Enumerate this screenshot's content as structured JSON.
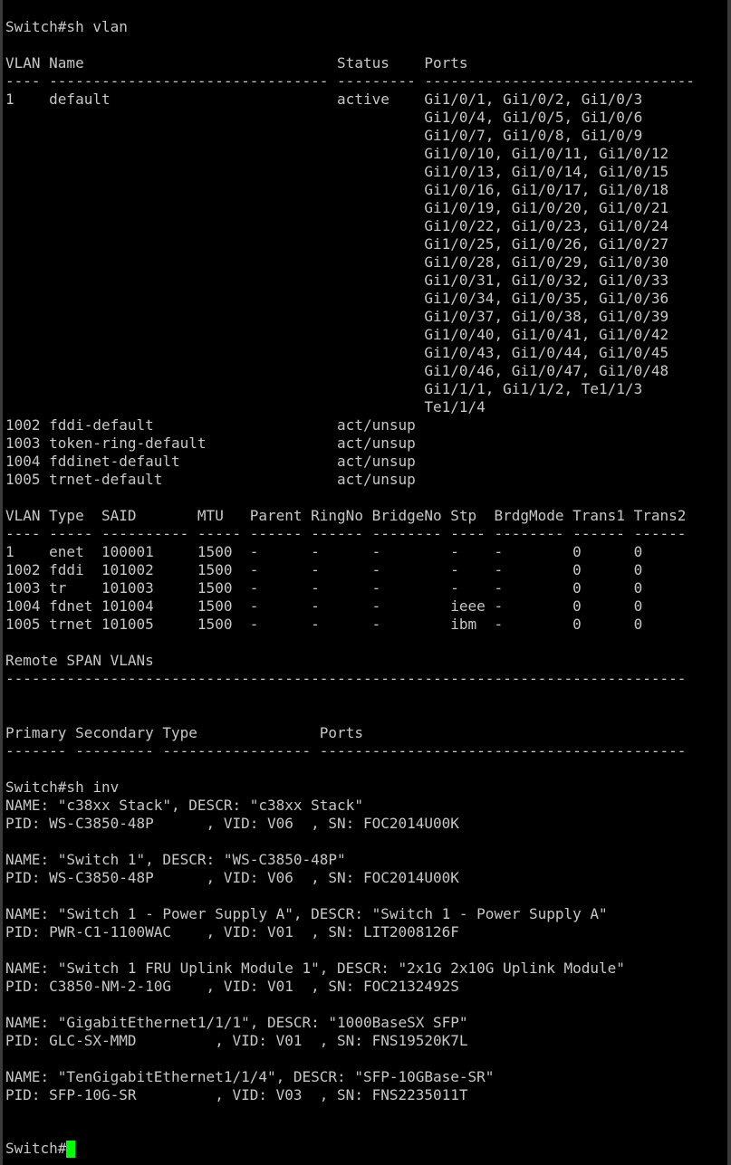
{
  "window": {
    "background": "#000000",
    "text_color": "#c7c7c7",
    "cursor_color": "#00ff00"
  },
  "terminal": {
    "lines": [
      "Switch#sh vlan",
      "",
      "VLAN Name                             Status    Ports",
      "---- -------------------------------- --------- -------------------------------",
      "1    default                          active    Gi1/0/1, Gi1/0/2, Gi1/0/3",
      "                                                Gi1/0/4, Gi1/0/5, Gi1/0/6",
      "                                                Gi1/0/7, Gi1/0/8, Gi1/0/9",
      "                                                Gi1/0/10, Gi1/0/11, Gi1/0/12",
      "                                                Gi1/0/13, Gi1/0/14, Gi1/0/15",
      "                                                Gi1/0/16, Gi1/0/17, Gi1/0/18",
      "                                                Gi1/0/19, Gi1/0/20, Gi1/0/21",
      "                                                Gi1/0/22, Gi1/0/23, Gi1/0/24",
      "                                                Gi1/0/25, Gi1/0/26, Gi1/0/27",
      "                                                Gi1/0/28, Gi1/0/29, Gi1/0/30",
      "                                                Gi1/0/31, Gi1/0/32, Gi1/0/33",
      "                                                Gi1/0/34, Gi1/0/35, Gi1/0/36",
      "                                                Gi1/0/37, Gi1/0/38, Gi1/0/39",
      "                                                Gi1/0/40, Gi1/0/41, Gi1/0/42",
      "                                                Gi1/0/43, Gi1/0/44, Gi1/0/45",
      "                                                Gi1/0/46, Gi1/0/47, Gi1/0/48",
      "                                                Gi1/1/1, Gi1/1/2, Te1/1/3",
      "                                                Te1/1/4",
      "1002 fddi-default                     act/unsup",
      "1003 token-ring-default               act/unsup",
      "1004 fddinet-default                  act/unsup",
      "1005 trnet-default                    act/unsup",
      "",
      "VLAN Type  SAID       MTU   Parent RingNo BridgeNo Stp  BrdgMode Trans1 Trans2",
      "---- ----- ---------- ----- ------ ------ -------- ---- -------- ------ ------",
      "1    enet  100001     1500  -      -      -        -    -        0      0",
      "1002 fddi  101002     1500  -      -      -        -    -        0      0",
      "1003 tr    101003     1500  -      -      -        -    -        0      0",
      "1004 fdnet 101004     1500  -      -      -        ieee -        0      0",
      "1005 trnet 101005     1500  -      -      -        ibm  -        0      0",
      "",
      "Remote SPAN VLANs",
      "------------------------------------------------------------------------------",
      "",
      "",
      "Primary Secondary Type              Ports",
      "------- --------- ----------------- ------------------------------------------",
      "",
      "Switch#sh inv",
      "NAME: \"c38xx Stack\", DESCR: \"c38xx Stack\"",
      "PID: WS-C3850-48P      , VID: V06  , SN: FOC2014U00K",
      "",
      "NAME: \"Switch 1\", DESCR: \"WS-C3850-48P\"",
      "PID: WS-C3850-48P      , VID: V06  , SN: FOC2014U00K",
      "",
      "NAME: \"Switch 1 - Power Supply A\", DESCR: \"Switch 1 - Power Supply A\"",
      "PID: PWR-C1-1100WAC    , VID: V01  , SN: LIT2008126F",
      "",
      "NAME: \"Switch 1 FRU Uplink Module 1\", DESCR: \"2x1G 2x10G Uplink Module\"",
      "PID: C3850-NM-2-10G    , VID: V01  , SN: FOC2132492S",
      "",
      "NAME: \"GigabitEthernet1/1/1\", DESCR: \"1000BaseSX SFP\"",
      "PID: GLC-SX-MMD         , VID: V01  , SN: FNS19520K7L",
      "",
      "NAME: \"TenGigabitEthernet1/1/4\", DESCR: \"SFP-10GBase-SR\"",
      "PID: SFP-10G-SR         , VID: V03  , SN: FNS2235011T"
    ],
    "prompt": "Switch#"
  }
}
